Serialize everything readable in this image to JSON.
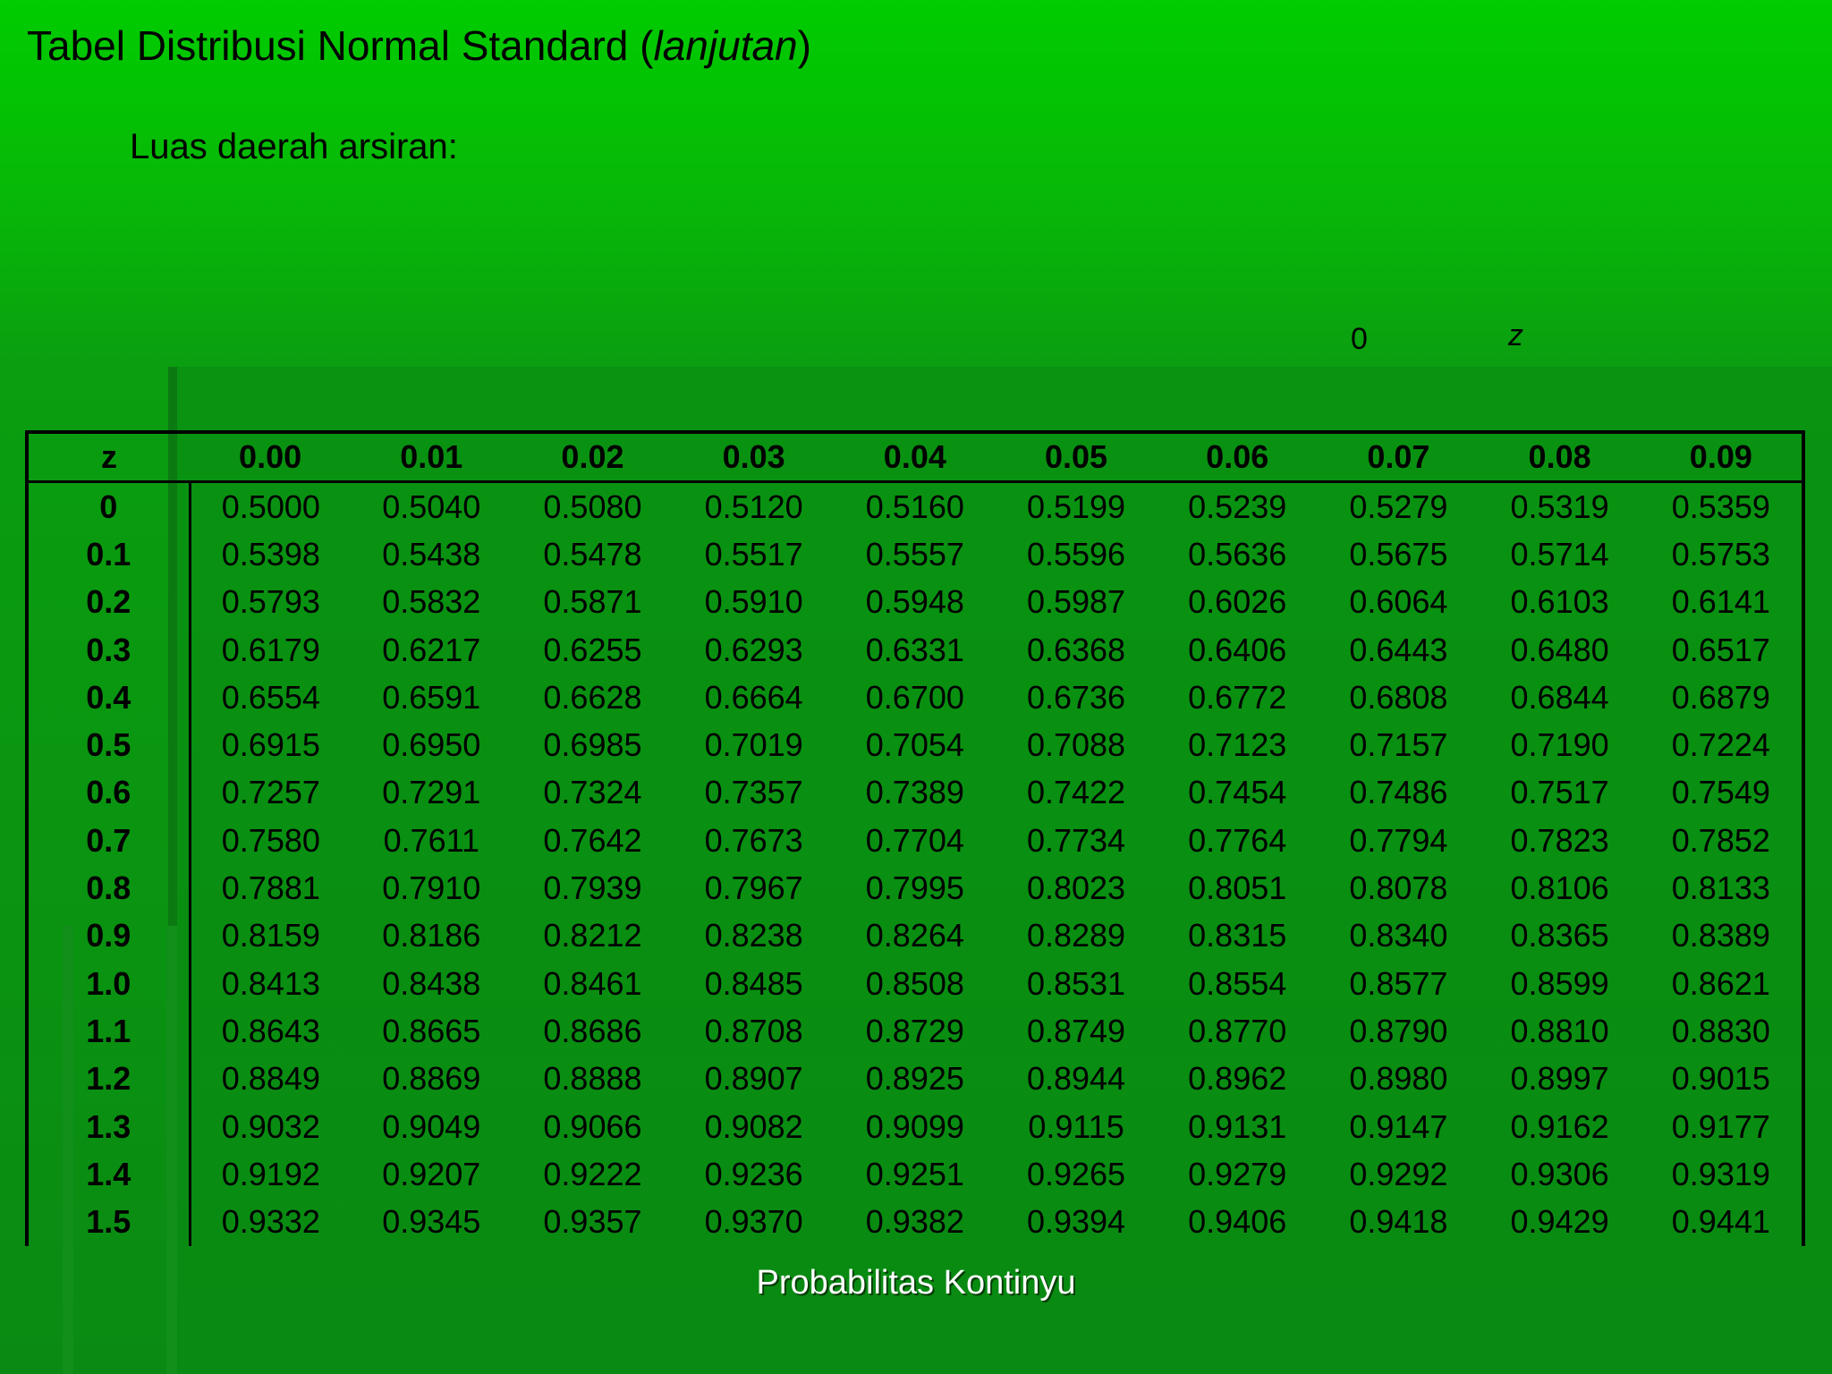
{
  "title_main": "Tabel Distribusi Normal Standard (",
  "title_italic": "lanjutan",
  "title_close": ")",
  "subtitle": "Luas daerah arsiran:",
  "figure_labels": {
    "zero": "0",
    "z": "z"
  },
  "table": {
    "headers": [
      "z",
      "0.00",
      "0.01",
      "0.02",
      "0.03",
      "0.04",
      "0.05",
      "0.06",
      "0.07",
      "0.08",
      "0.09"
    ],
    "rows": [
      [
        "0",
        "0.5000",
        "0.5040",
        "0.5080",
        "0.5120",
        "0.5160",
        "0.5199",
        "0.5239",
        "0.5279",
        "0.5319",
        "0.5359"
      ],
      [
        "0.1",
        "0.5398",
        "0.5438",
        "0.5478",
        "0.5517",
        "0.5557",
        "0.5596",
        "0.5636",
        "0.5675",
        "0.5714",
        "0.5753"
      ],
      [
        "0.2",
        "0.5793",
        "0.5832",
        "0.5871",
        "0.5910",
        "0.5948",
        "0.5987",
        "0.6026",
        "0.6064",
        "0.6103",
        "0.6141"
      ],
      [
        "0.3",
        "0.6179",
        "0.6217",
        "0.6255",
        "0.6293",
        "0.6331",
        "0.6368",
        "0.6406",
        "0.6443",
        "0.6480",
        "0.6517"
      ],
      [
        "0.4",
        "0.6554",
        "0.6591",
        "0.6628",
        "0.6664",
        "0.6700",
        "0.6736",
        "0.6772",
        "0.6808",
        "0.6844",
        "0.6879"
      ],
      [
        "0.5",
        "0.6915",
        "0.6950",
        "0.6985",
        "0.7019",
        "0.7054",
        "0.7088",
        "0.7123",
        "0.7157",
        "0.7190",
        "0.7224"
      ],
      [
        "0.6",
        "0.7257",
        "0.7291",
        "0.7324",
        "0.7357",
        "0.7389",
        "0.7422",
        "0.7454",
        "0.7486",
        "0.7517",
        "0.7549"
      ],
      [
        "0.7",
        "0.7580",
        "0.7611",
        "0.7642",
        "0.7673",
        "0.7704",
        "0.7734",
        "0.7764",
        "0.7794",
        "0.7823",
        "0.7852"
      ],
      [
        "0.8",
        "0.7881",
        "0.7910",
        "0.7939",
        "0.7967",
        "0.7995",
        "0.8023",
        "0.8051",
        "0.8078",
        "0.8106",
        "0.8133"
      ],
      [
        "0.9",
        "0.8159",
        "0.8186",
        "0.8212",
        "0.8238",
        "0.8264",
        "0.8289",
        "0.8315",
        "0.8340",
        "0.8365",
        "0.8389"
      ],
      [
        "1.0",
        "0.8413",
        "0.8438",
        "0.8461",
        "0.8485",
        "0.8508",
        "0.8531",
        "0.8554",
        "0.8577",
        "0.8599",
        "0.8621"
      ],
      [
        "1.1",
        "0.8643",
        "0.8665",
        "0.8686",
        "0.8708",
        "0.8729",
        "0.8749",
        "0.8770",
        "0.8790",
        "0.8810",
        "0.8830"
      ],
      [
        "1.2",
        "0.8849",
        "0.8869",
        "0.8888",
        "0.8907",
        "0.8925",
        "0.8944",
        "0.8962",
        "0.8980",
        "0.8997",
        "0.9015"
      ],
      [
        "1.3",
        "0.9032",
        "0.9049",
        "0.9066",
        "0.9082",
        "0.9099",
        "0.9115",
        "0.9131",
        "0.9147",
        "0.9162",
        "0.9177"
      ],
      [
        "1.4",
        "0.9192",
        "0.9207",
        "0.9222",
        "0.9236",
        "0.9251",
        "0.9265",
        "0.9279",
        "0.9292",
        "0.9306",
        "0.9319"
      ],
      [
        "1.5",
        "0.9332",
        "0.9345",
        "0.9357",
        "0.9370",
        "0.9382",
        "0.9394",
        "0.9406",
        "0.9418",
        "0.9429",
        "0.9441"
      ]
    ]
  },
  "footer": "Probabilitas Kontinyu",
  "colors": {
    "background_top": "#00cc00",
    "background_bottom": "#0a8a12",
    "text": "#000000",
    "footer_text": "#ffffff"
  }
}
